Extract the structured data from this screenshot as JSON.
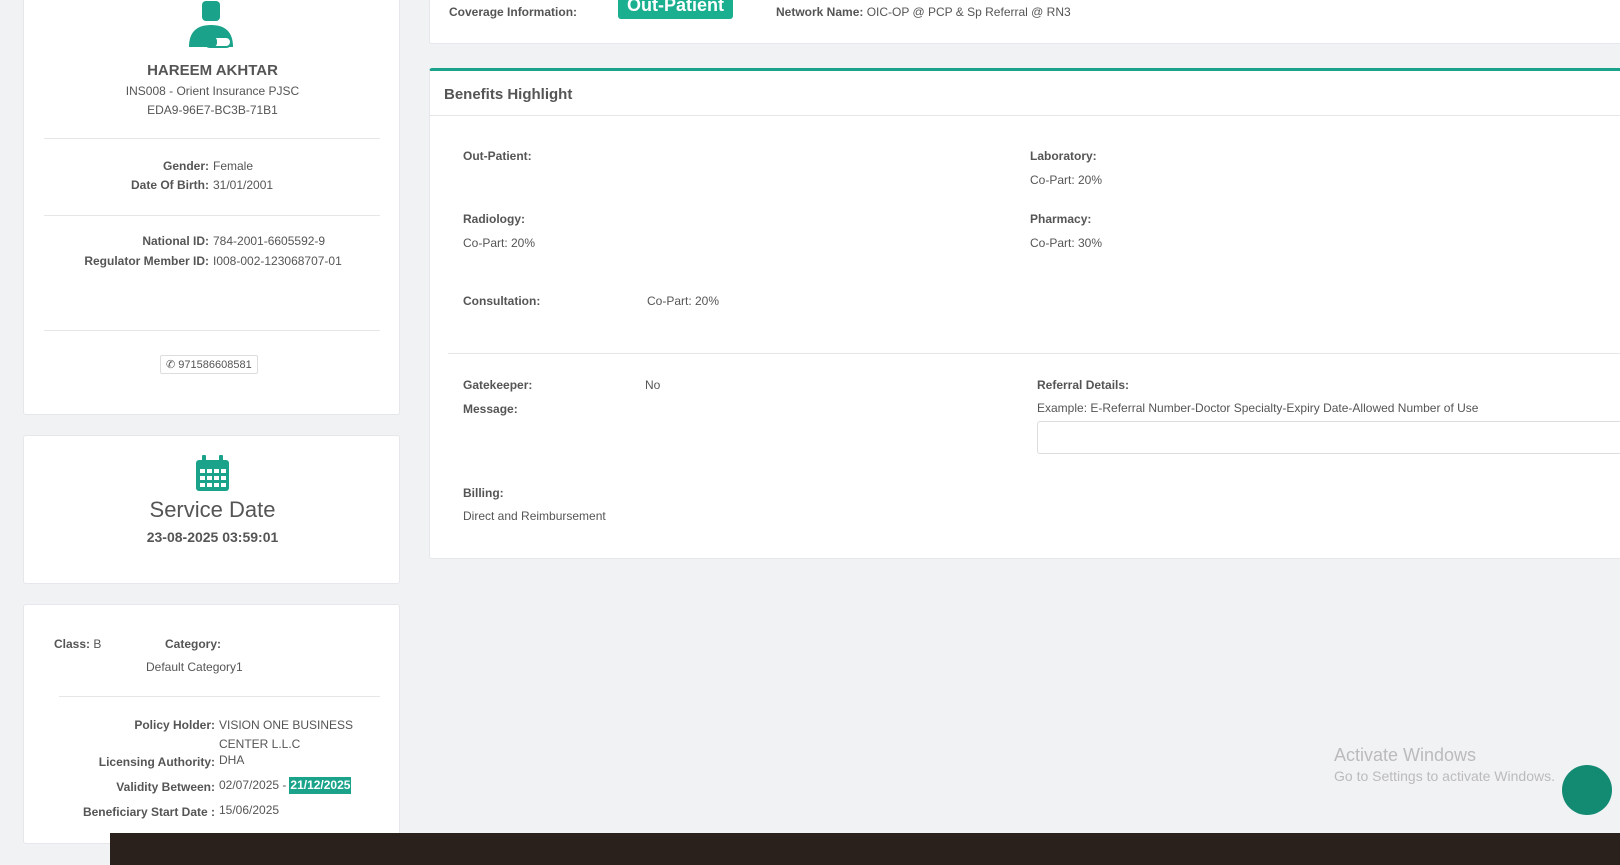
{
  "patient": {
    "name": "HAREEM AKHTAR",
    "insurer": "INS008 - Orient Insurance PJSC",
    "member_code": "EDA9-96E7-BC3B-71B1",
    "gender_label": "Gender:",
    "gender": "Female",
    "dob_label": "Date Of Birth:",
    "dob": "31/01/2001",
    "national_id_label": "National ID:",
    "national_id": "784-2001-6605592-9",
    "regulator_label": "Regulator Member ID:",
    "regulator_id": "I008-002-123068707-01",
    "phone": "971586608581"
  },
  "service": {
    "title": "Service Date",
    "datetime": "23-08-2025 03:59:01"
  },
  "policy": {
    "class_label": "Class:",
    "class": "B",
    "category_label": "Category:",
    "category": "Default Category1",
    "holder_label": "Policy Holder:",
    "holder": "VISION ONE BUSINESS CENTER L.L.C",
    "authority_label": "Licensing Authority:",
    "authority": "DHA",
    "validity_label": "Validity Between:",
    "validity_from": "02/07/2025 -",
    "validity_to": "21/12/2025",
    "start_label": "Beneficiary Start Date :",
    "start": "15/06/2025"
  },
  "coverage": {
    "label": "Coverage Information:",
    "badge": "Out-Patient",
    "network_label": "Network Name:",
    "network": "OIC-OP @ PCP & Sp Referral @ RN3"
  },
  "benefits": {
    "title": "Benefits Highlight",
    "outpatient": "Out-Patient:",
    "laboratory": "Laboratory:",
    "laboratory_value": "Co-Part: 20%",
    "radiology": "Radiology:",
    "radiology_value": "Co-Part: 20%",
    "pharmacy": "Pharmacy:",
    "pharmacy_value": "Co-Part: 30%",
    "consultation": "Consultation:",
    "consultation_value": "Co-Part: 20%",
    "gatekeeper": "Gatekeeper:",
    "gatekeeper_value": "No",
    "message": "Message:",
    "referral": "Referral Details:",
    "referral_hint": "Example: E-Referral Number-Doctor Specialty-Expiry Date-Allowed Number of Use",
    "billing": "Billing:",
    "billing_value": "Direct and Reimbursement"
  },
  "watermark": {
    "title": "Activate Windows",
    "subtitle": "Go to Settings to activate Windows."
  },
  "colors": {
    "accent": "#1aaf8f"
  }
}
